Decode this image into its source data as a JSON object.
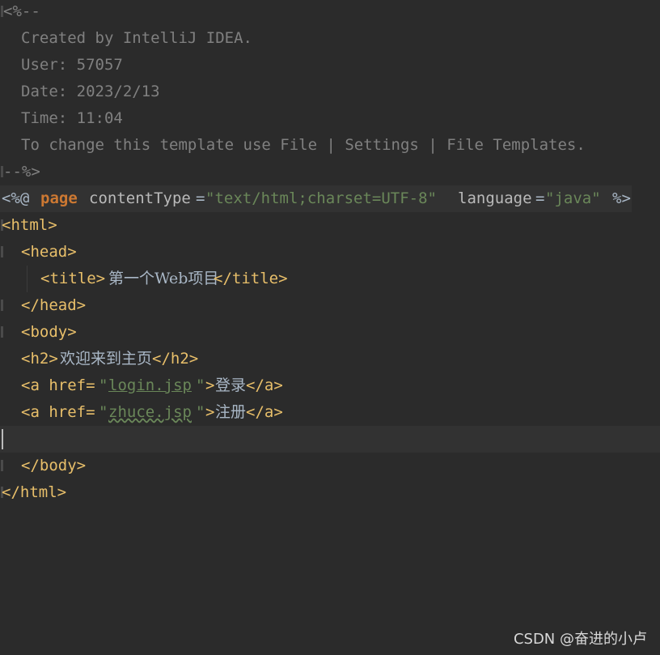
{
  "comment": {
    "open": "<%--",
    "created_by": "Created by IntelliJ IDEA.",
    "user": "User: 57057",
    "date": "Date: 2023/2/13",
    "time": "Time: 11:04",
    "note": "To change this template use File | Settings | File Templates.",
    "close": "--%>"
  },
  "directive": {
    "open": "<%@",
    "keyword": "page",
    "attr1": "contentType",
    "eq1": "=",
    "val1": "\"text/html;charset=UTF-8\"",
    "attr2": "language",
    "eq2": "=",
    "val2": "\"java\"",
    "close": "%>"
  },
  "code": {
    "html_open": "<html>",
    "head_open": "<head>",
    "title_open": "<title>",
    "title_text": "第一个Web项目",
    "title_close": "</title>",
    "head_close": "</head>",
    "body_open": "<body>",
    "h2_open": "<h2>",
    "h2_text": "欢迎来到主页",
    "h2_close": "</h2>",
    "a1_open": "<a href=",
    "a1_quote_open": "\"",
    "a1_href": "login.jsp",
    "a1_quote_close": "\"",
    "a1_gt": ">",
    "a1_text": "登录",
    "a1_close": "</a>",
    "a2_open": "<a href=",
    "a2_quote_open": "\"",
    "a2_href": "zhuce.jsp",
    "a2_quote_close": "\"",
    "a2_gt": ">",
    "a2_text": "注册",
    "a2_close": "</a>",
    "body_close": "</body>",
    "html_close": "</html>"
  },
  "watermark": "CSDN @奋进的小卢",
  "colors": {
    "background": "#2b2b2b",
    "comment": "#808080",
    "tag": "#e8bf6a",
    "string": "#6a8759",
    "keyword": "#cc7832",
    "text": "#a9b7c6",
    "bulb": "#f0c23b"
  },
  "icons": {
    "intention": "lightbulb-icon"
  }
}
